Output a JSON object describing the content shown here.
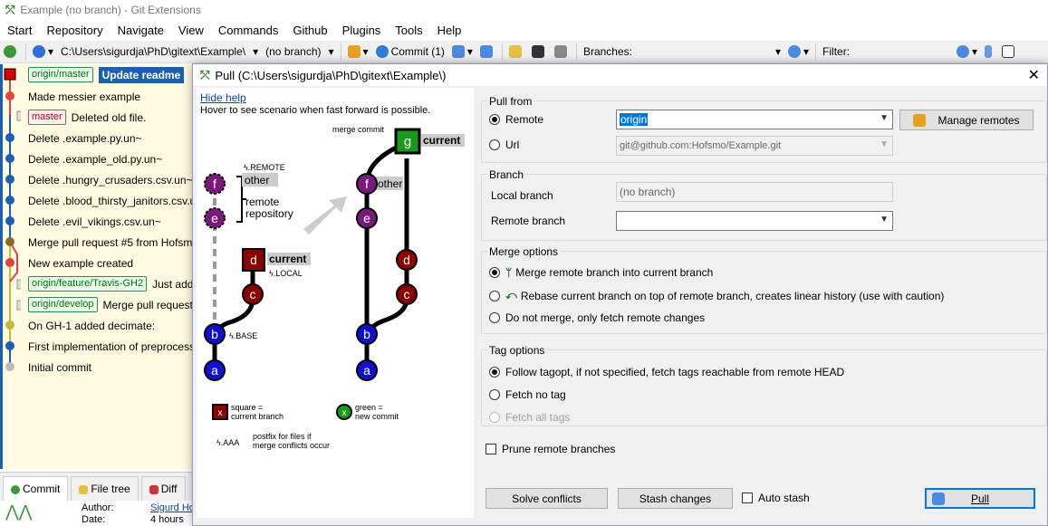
{
  "window": {
    "title": "Example (no branch) - Git Extensions"
  },
  "menu": [
    "Start",
    "Repository",
    "Navigate",
    "View",
    "Commands",
    "Github",
    "Plugins",
    "Tools",
    "Help"
  ],
  "toolbar": {
    "path": "C:\\Users\\sigurdja\\PhD\\gitext\\Example\\",
    "branch": "(no branch)",
    "commit_label": "Commit (1)",
    "branches_label": "Branches:",
    "filter_label": "Filter:"
  },
  "revisions": [
    {
      "badge": "origin/master",
      "badge_color": "green",
      "message": "Update readme",
      "bold": true
    },
    {
      "badge": "",
      "message": "Made messier example"
    },
    {
      "badge": "master",
      "badge_color": "red",
      "message": "Deleted old file."
    },
    {
      "badge": "",
      "message": "Delete .example.py.un~"
    },
    {
      "badge": "",
      "message": "Delete .example_old.py.un~"
    },
    {
      "badge": "",
      "message": "Delete .hungry_crusaders.csv.un~"
    },
    {
      "badge": "",
      "message": "Delete .blood_thirsty_janitors.csv.un"
    },
    {
      "badge": "",
      "message": "Delete .evil_vikings.csv.un~"
    },
    {
      "badge": "",
      "message": "Merge pull request #5 from Hofsmo/f"
    },
    {
      "badge": "",
      "message": "New example created"
    },
    {
      "badge": "origin/feature/Travis-GH2",
      "badge_color": "green",
      "message": "Just add"
    },
    {
      "badge": "origin/develop",
      "badge_color": "green",
      "message": "Merge pull request #"
    },
    {
      "badge": "",
      "message": "On GH-1 added decimate:"
    },
    {
      "badge": "",
      "message": "First implementation of preprocess_da"
    },
    {
      "badge": "",
      "message": "Initial commit"
    }
  ],
  "bottom": {
    "tabs": [
      "Commit",
      "File tree",
      "Diff"
    ],
    "author_label": "Author:",
    "author_value": "Sigurd Ho",
    "date_label": "Date:",
    "date_value": "4 hours ago"
  },
  "dialog": {
    "title": "Pull (C:\\Users\\sigurdja\\PhD\\gitext\\Example\\)",
    "hide_help": "Hide help",
    "hover_hint": "Hover to see scenario when fast forward is possible.",
    "diagram": {
      "merge_commit": "merge commit",
      "current": "current",
      "other": "other",
      "remote": "ϟ.REMOTE",
      "remote_repo_1": "remote",
      "remote_repo_2": "repository",
      "local": "ϟ.LOCAL",
      "base": "ϟ.BASE",
      "legend_square": "square =",
      "legend_square_2": "current branch",
      "legend_green": "green =",
      "legend_green_2": "new commit",
      "legend_postfix_icon": "ϟ.AAA",
      "legend_postfix": "postfix for files if",
      "legend_postfix_2": "merge conflicts occur",
      "nodes_left": [
        "f",
        "e",
        "d",
        "c",
        "b",
        "a"
      ],
      "nodes_right": [
        "g",
        "f",
        "e",
        "d",
        "c",
        "b",
        "a"
      ]
    },
    "pull_from": {
      "title": "Pull from",
      "remote_label": "Remote",
      "remote_value": "origin",
      "manage_remotes": "Manage remotes",
      "url_label": "Url",
      "url_value": "git@github.com:Hofsmo/Example.git"
    },
    "branch": {
      "title": "Branch",
      "local_label": "Local branch",
      "local_value": "(no branch)",
      "remote_label": "Remote branch",
      "remote_value": ""
    },
    "merge_options": {
      "title": "Merge options",
      "merge": "Merge remote branch into current branch",
      "rebase": "Rebase current branch on top of remote branch, creates linear history (use with caution)",
      "fetch": "Do not merge, only fetch remote changes"
    },
    "tag_options": {
      "title": "Tag options",
      "follow": "Follow tagopt, if not specified, fetch tags reachable from remote HEAD",
      "no_tag": "Fetch no tag",
      "all_tags": "Fetch all tags"
    },
    "prune": "Prune remote branches",
    "solve_conflicts": "Solve conflicts",
    "stash_changes": "Stash changes",
    "auto_stash": "Auto stash",
    "pull": "Pull"
  }
}
